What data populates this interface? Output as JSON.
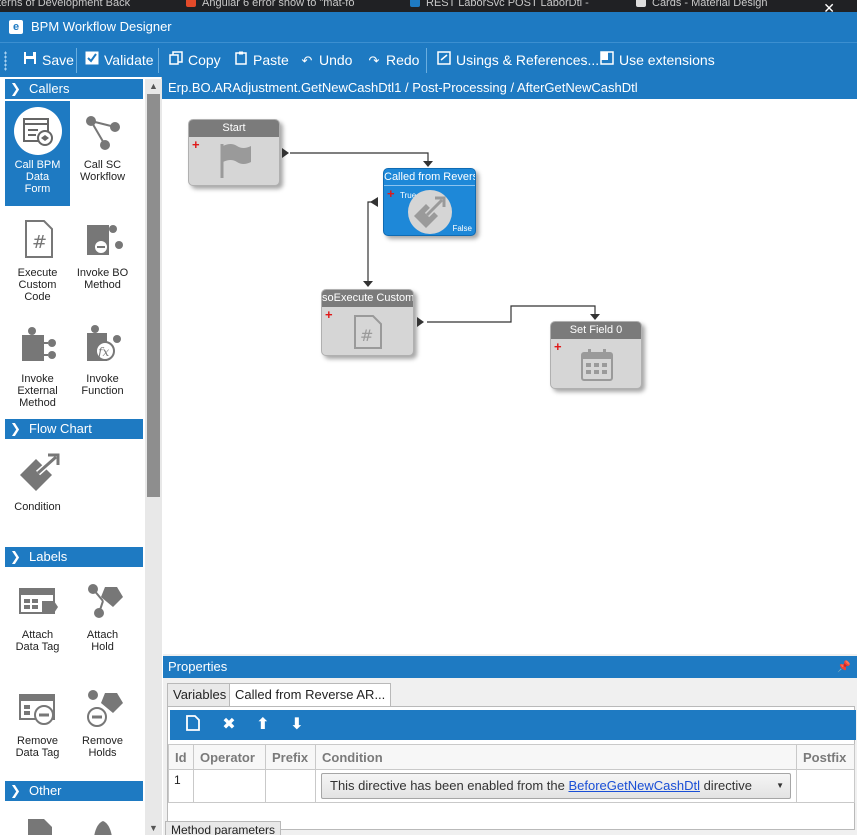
{
  "browser_tabs": [
    {
      "label": "terns of Development Back",
      "color": "#f0a020"
    },
    {
      "label": "Angular 6 error show to \"mat-fo",
      "color": "#e24a2a"
    },
    {
      "label": "REST LaborSvc POST LaborDtl -",
      "color": "#1e7ac2"
    },
    {
      "label": "Cards - Material Design",
      "color": "#dddddd"
    }
  ],
  "window": {
    "icon_letter": "e",
    "title": "BPM Workflow Designer",
    "close_glyph": "✕"
  },
  "toolbar": {
    "save": "Save",
    "validate": "Validate",
    "copy": "Copy",
    "paste": "Paste",
    "undo": "Undo",
    "redo": "Redo",
    "usings": "Usings & References...",
    "extensions": "Use extensions"
  },
  "toolbox": {
    "categories": {
      "callers": "Callers",
      "flowchart": "Flow Chart",
      "labels": "Labels",
      "other": "Other"
    },
    "tools": {
      "call_bpm_data_form": "Call BPM Data Form",
      "call_sc_workflow": "Call SC Workflow",
      "execute_custom_code": "Execute Custom Code",
      "invoke_bo_method": "Invoke BO Method",
      "invoke_external_method": "Invoke External Method",
      "invoke_function": "Invoke Function",
      "condition": "Condition",
      "attach_data_tag": "Attach Data Tag",
      "attach_hold": "Attach Hold",
      "remove_data_tag": "Remove Data Tag",
      "remove_holds": "Remove Holds"
    }
  },
  "breadcrumb": "Erp.BO.ARAdjustment.GetNewCashDtl1 / Post-Processing / AfterGetNewCashDtl",
  "canvas": {
    "nodes": {
      "start": "Start",
      "condition": "Called from Revers",
      "condition_true": "True",
      "condition_false": "False",
      "execute": "soExecute Custom",
      "setfield": "Set Field 0"
    }
  },
  "properties": {
    "title": "Properties",
    "tabs": [
      "Variables",
      "Called from Reverse AR..."
    ],
    "active_tab": 1,
    "grid": {
      "columns": [
        "Id",
        "Operator",
        "Prefix",
        "Condition",
        "Postfix"
      ],
      "rows": [
        {
          "id": "1",
          "operator": "",
          "prefix": "",
          "condition_pre": "This directive has been enabled from the ",
          "condition_link": "BeforeGetNewCashDtl",
          "condition_post": " directive",
          "postfix": ""
        }
      ]
    },
    "bottom_tab": "Method parameters"
  },
  "colors": {
    "accent": "#1e7ac2",
    "node_active": "#1e88d8",
    "node_header": "#7b7b7b",
    "node_body": "#d6d6d6",
    "plus": "#e01919",
    "link": "#1a4fd6"
  }
}
